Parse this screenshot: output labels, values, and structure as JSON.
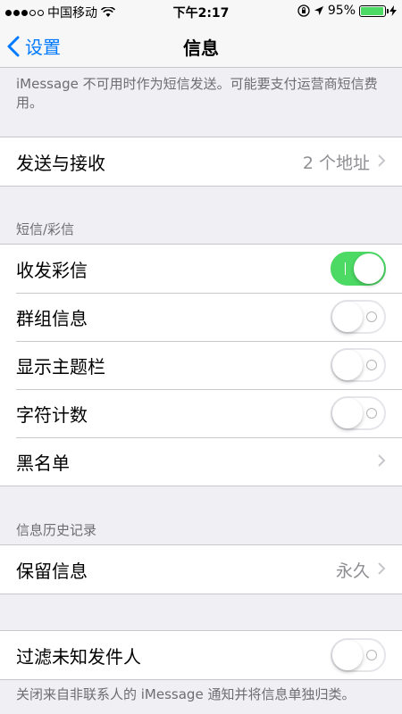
{
  "status_bar": {
    "carrier": "中国移动",
    "time": "下午2:17",
    "battery_percent": "95%",
    "battery_level": 0.95,
    "signal_bars_filled": 3,
    "signal_bars_total": 5
  },
  "nav": {
    "back_label": "设置",
    "title": "信息"
  },
  "top_note": "iMessage 不可用时作为短信发送。可能要支付运营商短信费用。",
  "send_receive": {
    "label": "发送与接收",
    "value": "2 个地址"
  },
  "sms_section": {
    "header": "短信/彩信",
    "rows": [
      {
        "label": "收发彩信",
        "toggle": true
      },
      {
        "label": "群组信息",
        "toggle": false
      },
      {
        "label": "显示主题栏",
        "toggle": false
      },
      {
        "label": "字符计数",
        "toggle": false
      },
      {
        "label": "黑名单"
      }
    ]
  },
  "history_section": {
    "header": "信息历史记录",
    "keep_label": "保留信息",
    "keep_value": "永久"
  },
  "filter": {
    "label": "过滤未知发件人",
    "toggle": false,
    "note": "关闭来自非联系人的 iMessage 通知并将信息单独归类。"
  },
  "colors": {
    "accent": "#007aff",
    "toggle_on": "#4cd964",
    "background": "#efeff4"
  }
}
